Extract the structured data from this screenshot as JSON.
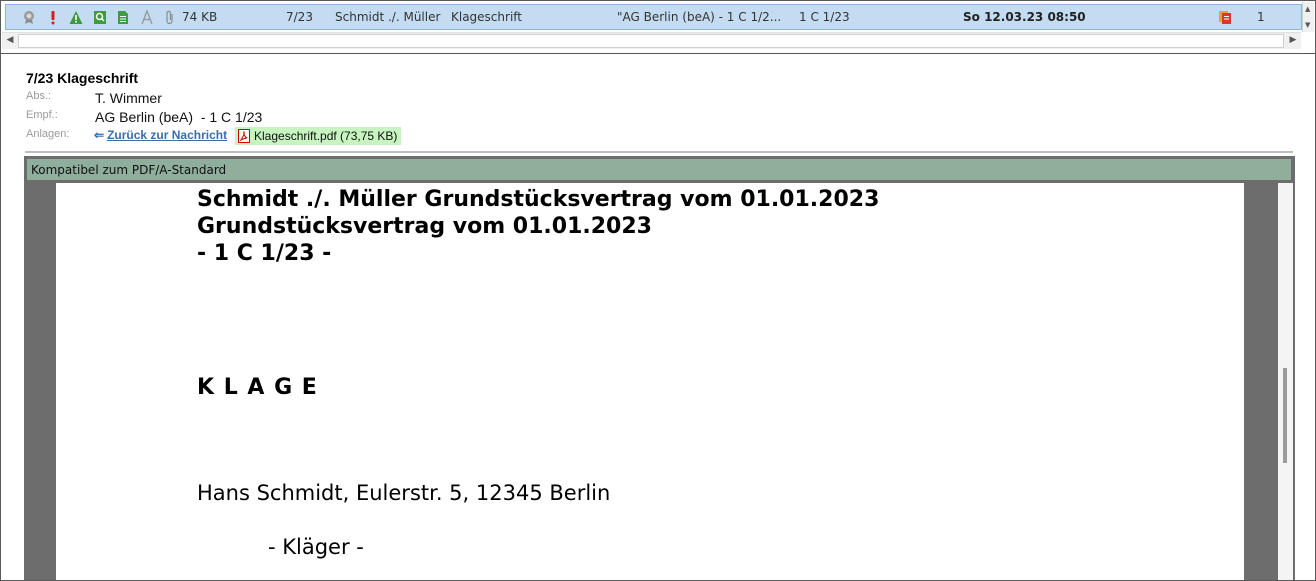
{
  "message_row": {
    "size": "74 KB",
    "number": "7/23",
    "parties": "Schmidt ./. Müller",
    "doc_type": "Klageschrift",
    "recipient": "\"AG Berlin (beA)   - 1 C 1/2...",
    "case_ref": "1 C 1/23",
    "datetime": "So 12.03.23 08:50",
    "count": "1"
  },
  "header": {
    "subject": "7/23 Klageschrift",
    "sender_label": "Abs.:",
    "sender": "T. Wimmer",
    "recipient_label": "Empf.:",
    "recipient": "AG Berlin (beA)  - 1 C 1/23",
    "attachments_label": "Anlagen:",
    "back_link": "Zurück zur Nachricht",
    "attachment": "Klageschrift.pdf (73,75 KB)"
  },
  "viewer": {
    "pdfa_notice": "Kompatibel zum PDF/A-Standard"
  },
  "document": {
    "line1": "Schmidt ./. Müller Grundstücksvertrag vom 01.01.2023",
    "line2": "Grundstücksvertrag vom 01.01.2023",
    "line3": "- 1 C 1/23 -",
    "title": "K L A G E",
    "party": "Hans Schmidt, Eulerstr. 5, 12345 Berlin",
    "role": "- Kläger -"
  },
  "colors": {
    "row_selected": "#c4dcf2",
    "pdfa_bar": "#8fae9c",
    "attachment_bg": "#c7f4c0",
    "link": "#3a6ea8"
  }
}
